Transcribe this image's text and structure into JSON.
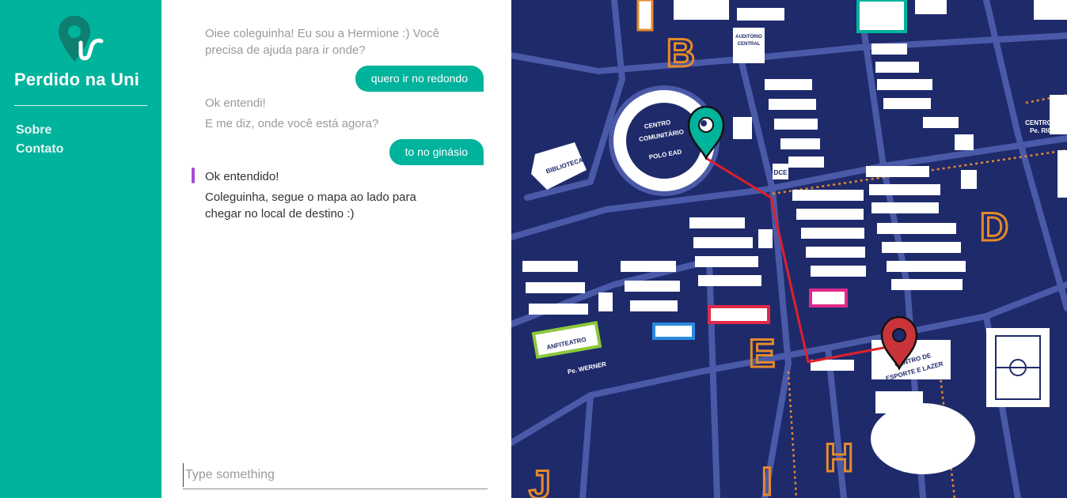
{
  "sidebar": {
    "brand": "Perdido na Uni",
    "nav": [
      {
        "label": "Sobre"
      },
      {
        "label": "Contato"
      }
    ]
  },
  "chat": {
    "messages": [
      {
        "from": "bot",
        "text": "Oiee coleguinha! Eu sou a Hermione :) Você precisa de ajuda para ir onde?"
      },
      {
        "from": "user",
        "text": "quero ir no redondo"
      },
      {
        "from": "bot",
        "text": "Ok entendi!"
      },
      {
        "from": "bot",
        "text": "E me diz, onde você está agora?"
      },
      {
        "from": "user",
        "text": "to no ginásio"
      },
      {
        "from": "bot",
        "text": "Ok entendido!"
      },
      {
        "from": "bot",
        "text": "Coleguinha, segue o mapa ao lado para chegar no local de destino :)"
      }
    ],
    "input": {
      "placeholder": "Type something",
      "value": ""
    }
  },
  "map": {
    "sectors": [
      "B",
      "D",
      "E",
      "H",
      "I",
      "J"
    ],
    "labels": {
      "centro_comunitario": [
        "CENTRO",
        "COMUNITÁRIO",
        "POLO EAD"
      ],
      "biblioteca": "BIBLIOTECA",
      "auditorio": [
        "AUDITÓRIO",
        "CENTRAL"
      ],
      "dce": "DCE",
      "centro_rick": [
        "CENTRO",
        "Pe. RICK"
      ],
      "anfiteatro": [
        "ANFITEATRO",
        "Pe. WERNER"
      ],
      "centro_esporte": [
        "CENTRO DE",
        "ESPORTE E LAZER"
      ]
    },
    "colors": {
      "background": "#1f2a6b",
      "road": "#4a5aa8",
      "origin_pin": "#00b39c",
      "destination_pin": "#c9343a",
      "route": "#e0202a"
    },
    "pins": [
      {
        "name": "origin",
        "icon": "map-pin-icon"
      },
      {
        "name": "destination",
        "icon": "map-pin-icon"
      }
    ]
  },
  "theme": {
    "accent": "#00b39c",
    "active_marker": "#a64bd6"
  }
}
